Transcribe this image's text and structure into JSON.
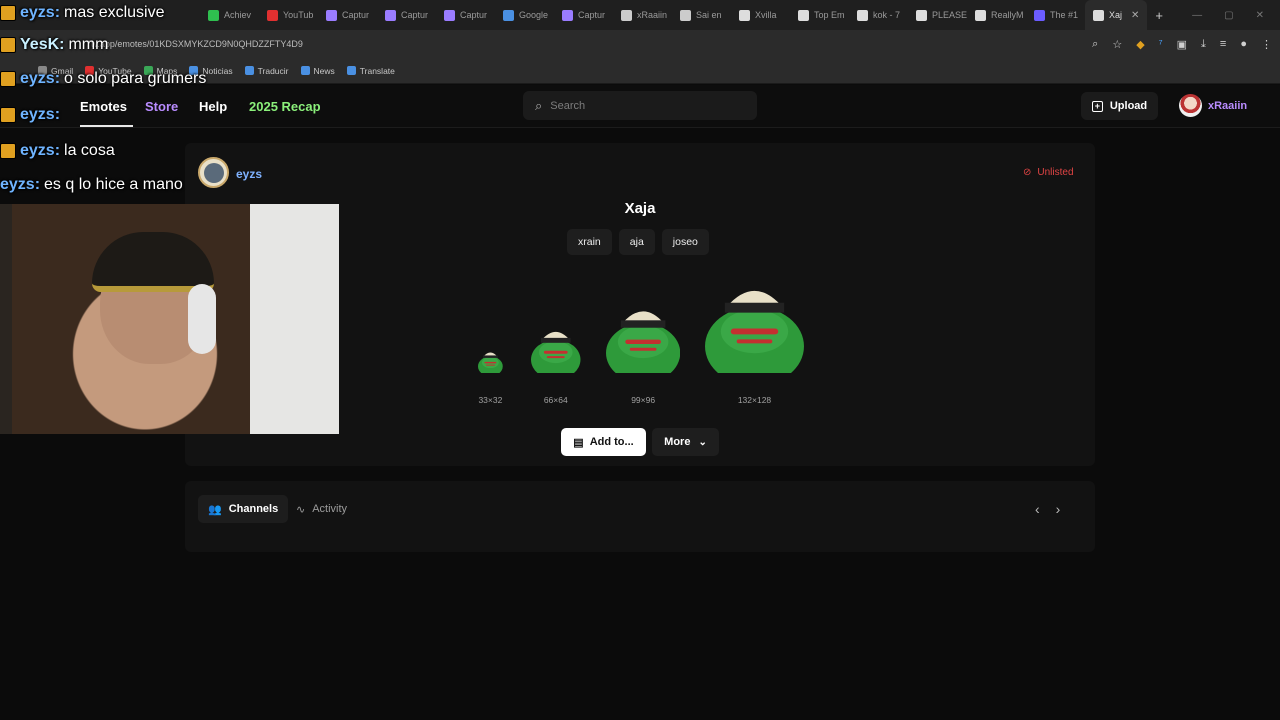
{
  "tabs": [
    {
      "label": "Achiev",
      "color": "#2fbf4f"
    },
    {
      "label": "YouTub",
      "color": "#e03030"
    },
    {
      "label": "Captur",
      "color": "#9a7cff"
    },
    {
      "label": "Captur",
      "color": "#9a7cff"
    },
    {
      "label": "Captur",
      "color": "#9a7cff"
    },
    {
      "label": "Google",
      "color": "#4a90e2"
    },
    {
      "label": "Captur",
      "color": "#9a7cff"
    },
    {
      "label": "xRaaiin",
      "color": "#cccccc"
    },
    {
      "label": "Sai en",
      "color": "#cccccc"
    },
    {
      "label": "Xvilla",
      "color": "#dddddd"
    },
    {
      "label": "Top Em",
      "color": "#dddddd"
    },
    {
      "label": "kok - 7",
      "color": "#dddddd"
    },
    {
      "label": "PLEASE",
      "color": "#dddddd"
    },
    {
      "label": "ReallyM",
      "color": "#dddddd"
    },
    {
      "label": "The #1",
      "color": "#6b5cff"
    }
  ],
  "active_tab": {
    "label": "Xaj"
  },
  "address": {
    "url": "7tv.app/emotes/01KDSXMYKZCD9N0QHDZZFTY4D9"
  },
  "bookmarks": [
    {
      "label": "Gmail",
      "color": "#888"
    },
    {
      "label": "YouTube",
      "color": "#e03030"
    },
    {
      "label": "Maps",
      "color": "#3aa757"
    },
    {
      "label": "Noticias",
      "color": "#4a90e2"
    },
    {
      "label": "Traducir",
      "color": "#4a90e2"
    },
    {
      "label": "News",
      "color": "#4a90e2"
    },
    {
      "label": "Translate",
      "color": "#4a90e2"
    }
  ],
  "nav": {
    "emotes": "Emotes",
    "store": "Store",
    "help": "Help",
    "recap": "2025 Recap"
  },
  "search": {
    "placeholder": "Search"
  },
  "header": {
    "upload": "Upload",
    "username": "xRaaiin"
  },
  "emote": {
    "owner": "eyzs",
    "status": "Unlisted",
    "name": "Xaja",
    "tags": [
      "xrain",
      "aja",
      "joseo"
    ],
    "sizes": [
      {
        "label": "33×32",
        "w": 33
      },
      {
        "label": "66×64",
        "w": 66
      },
      {
        "label": "99×96",
        "w": 99
      },
      {
        "label": "132×128",
        "w": 132
      }
    ],
    "add_button": "Add to...",
    "more_button": "More"
  },
  "section_tabs": {
    "channels": "Channels",
    "activity": "Activity"
  },
  "chat_overlay": [
    {
      "nick": "eyzs",
      "text": "mas exclusive"
    },
    {
      "nick": "YesK",
      "text": "mmm"
    },
    {
      "nick": "eyzs",
      "text": "o solo para grumers"
    },
    {
      "nick": "eyzs",
      "text": ""
    },
    {
      "nick": "eyzs",
      "text": "la cosa"
    },
    {
      "nick": "eyzs",
      "text": "es q lo hice a mano"
    }
  ],
  "colors": {
    "accent": "#b98cff",
    "recap": "#8bf07b",
    "owner": "#7fb2ff",
    "unlisted": "#e04444"
  }
}
